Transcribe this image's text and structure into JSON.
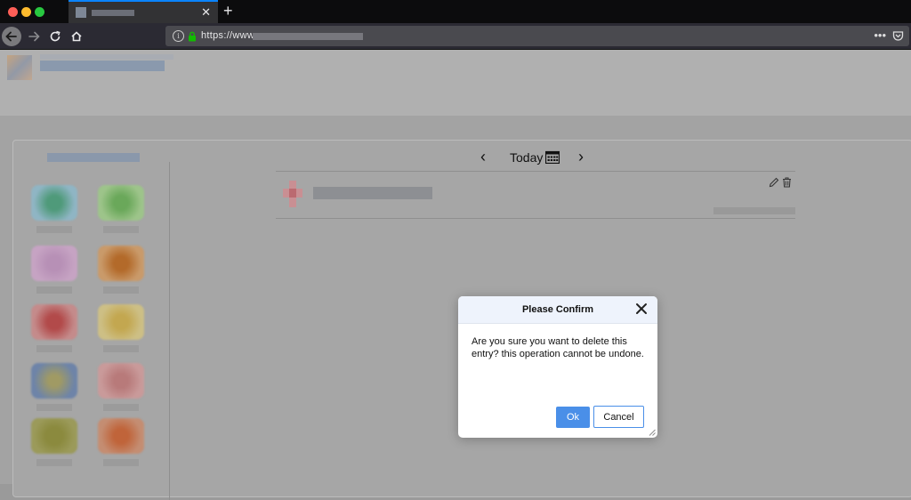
{
  "browser": {
    "tab_close": "✕",
    "new_tab": "+",
    "url_prefix": "https://www",
    "back_icon": "arrow-left-icon",
    "forward_icon": "arrow-right-icon",
    "reload_icon": "reload-icon",
    "home_icon": "home-icon",
    "more_label": "•••"
  },
  "toolbar": {
    "today_label": "Today",
    "prev_label": "‹",
    "next_label": "›"
  },
  "dialog": {
    "title": "Please Confirm",
    "message": "Are you sure you want to delete this entry? this operation cannot be undone.",
    "ok_label": "Ok",
    "cancel_label": "Cancel"
  },
  "colors": {
    "tab_accent": "#0a84ff",
    "primary_button": "#4a8fe8",
    "modal_header": "#eef3fc",
    "lock_green": "#12bc00"
  }
}
